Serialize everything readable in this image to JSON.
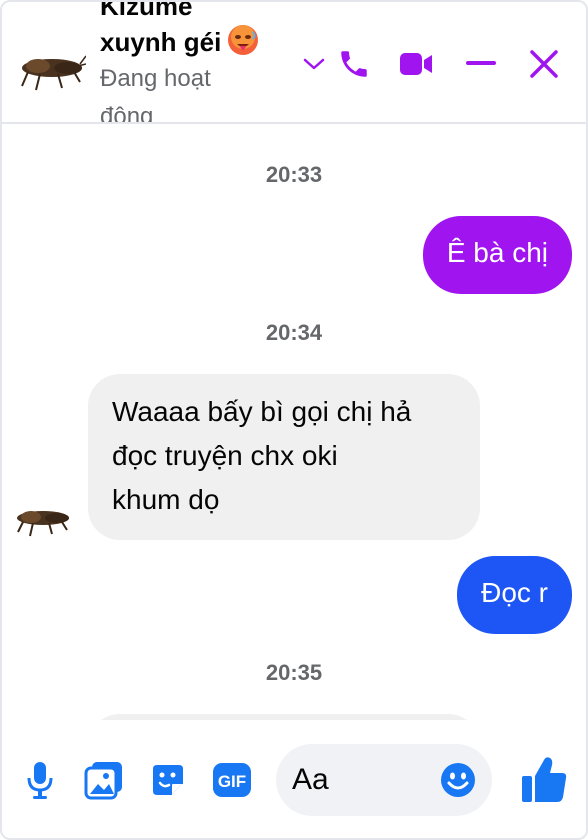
{
  "header": {
    "name_line1": "Kizume",
    "name_line2": "xuynh géi",
    "status_line1": "Đang hoạt",
    "status_line2": "động"
  },
  "messages": [
    {
      "type": "timestamp",
      "text": "20:33"
    },
    {
      "type": "outgoing",
      "text": "Ê bà chị",
      "color": "#a014ef"
    },
    {
      "type": "timestamp",
      "text": "20:34"
    },
    {
      "type": "incoming",
      "lines": [
        "Waaaa bấy bì gọi chị hả",
        "đọc truyện chx oki",
        "khum dọ"
      ]
    },
    {
      "type": "outgoing",
      "text": "Đọc r",
      "color": "#1e55f5"
    },
    {
      "type": "timestamp",
      "text": "20:35"
    }
  ],
  "composer": {
    "placeholder": "Aa"
  },
  "colors": {
    "accent": "#a014ef",
    "outgoing_blue": "#1e55f5",
    "composer_icons": "#1877f2"
  },
  "icons": [
    "chevron-down-icon",
    "phone-icon",
    "video-icon",
    "minimize-icon",
    "close-icon",
    "microphone-icon",
    "photo-icon",
    "sticker-icon",
    "gif-icon",
    "emoji-icon",
    "thumbs-up-icon"
  ]
}
